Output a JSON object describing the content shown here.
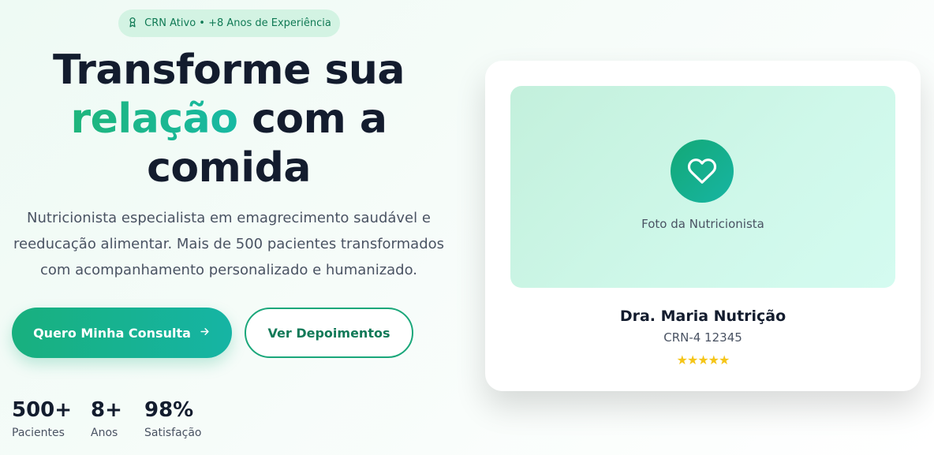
{
  "hero": {
    "badge": {
      "icon": "award-icon",
      "text": "CRN Ativo • +8 Anos de Experiência"
    },
    "headline": {
      "line1": "Transforme sua",
      "accent": "relação",
      "line2_rest": " com a",
      "line3": "comida"
    },
    "subtitle": "Nutricionista especialista em emagrecimento saudável e reeducação alimentar. Mais de 500 pacientes transformados com acompanhamento personalizado e humanizado.",
    "primary_button": {
      "label": "Quero Minha Consulta",
      "icon": "arrow-right-icon"
    },
    "secondary_button": {
      "label": "Ver Depoimentos"
    },
    "stats": [
      {
        "value": "500+",
        "label": "Pacientes"
      },
      {
        "value": "8+",
        "label": "Anos"
      },
      {
        "value": "98%",
        "label": "Satisfação"
      }
    ]
  },
  "profile_card": {
    "photo_icon": "heart-icon",
    "photo_label": "Foto da Nutricionista",
    "name": "Dra. Maria Nutrição",
    "crn": "CRN-4 12345",
    "rating": 5,
    "stars": "★★★★★"
  },
  "colors": {
    "accent": "#1fb57c",
    "accent_dark": "#127a58",
    "headline": "#131c2e",
    "badge_bg": "#d3f3e3",
    "star": "#f5c518"
  }
}
